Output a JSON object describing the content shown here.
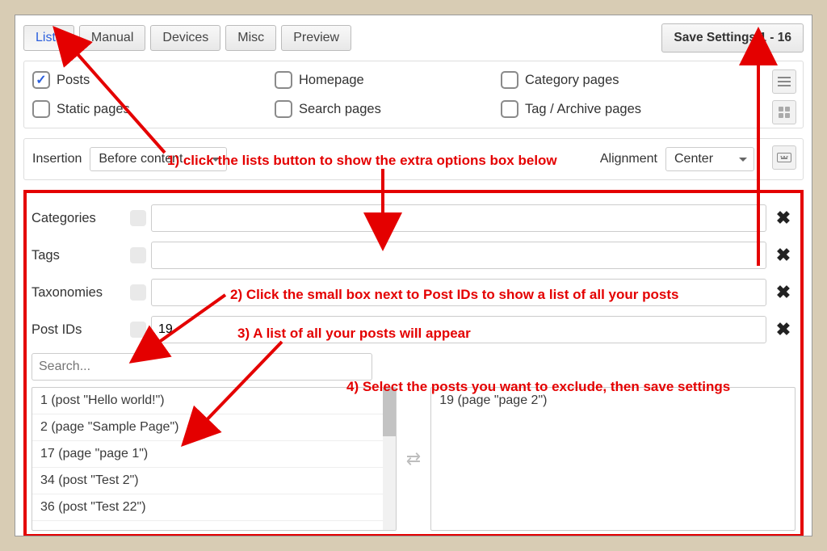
{
  "tabs": {
    "lists": "Lists",
    "manual": "Manual",
    "devices": "Devices",
    "misc": "Misc",
    "preview": "Preview"
  },
  "save_button": "Save Settings 1 - 16",
  "options": {
    "posts": "Posts",
    "static_pages": "Static pages",
    "homepage": "Homepage",
    "search_pages": "Search pages",
    "category_pages": "Category pages",
    "tag_archive": "Tag / Archive pages"
  },
  "insertion": {
    "label": "Insertion",
    "value": "Before content"
  },
  "alignment": {
    "label": "Alignment",
    "value": "Center"
  },
  "filters": {
    "categories": "Categories",
    "tags": "Tags",
    "taxonomies": "Taxonomies",
    "post_ids": "Post IDs",
    "post_ids_value": "19"
  },
  "search": {
    "placeholder": "Search..."
  },
  "available_posts": [
    "1 (post \"Hello world!\")",
    "2 (page \"Sample Page\")",
    "17 (page \"page 1\")",
    "34 (post \"Test 2\")",
    "36 (post \"Test 22\")"
  ],
  "selected_posts": [
    "19 (page \"page 2\")"
  ],
  "annotations": {
    "a1": "1) click the lists button to show the extra options box below",
    "a2": "2) Click the small box next to Post IDs to show a list of all your posts",
    "a3": "3) A list of all your posts will appear",
    "a4": "4) Select the posts you want to exclude, then save settings"
  }
}
